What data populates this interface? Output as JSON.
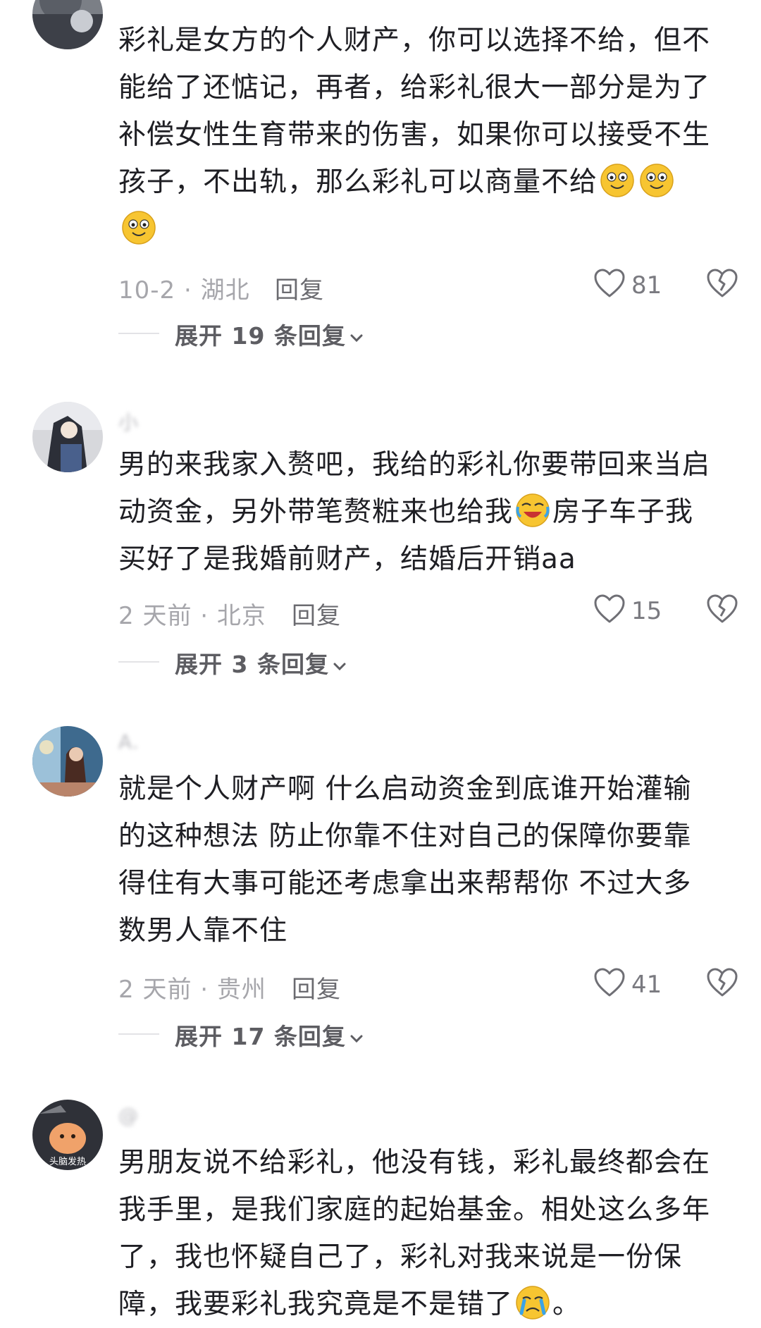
{
  "comments": [
    {
      "content_lines": [
        "彩礼是女方的个人财产，你可以选择不给，但不",
        "能给了还惦记，再者，给彩礼很大一部分是为了",
        "补偿女性生育带来的伤害，如果你可以接受不生",
        "孩子，不出轨，那么彩礼可以商量不给"
      ],
      "emojis": [
        "smile-emoji",
        "smile-emoji",
        "smile-emoji"
      ],
      "date_location": "10-2 · 湖北",
      "reply_label": "回复",
      "likes": "81",
      "expand_label": "展开 19 条回复"
    },
    {
      "username": "小",
      "content_lines": [
        "男的来我家入赘吧，我给的彩礼你要带回来当启",
        "动资金，另外带笔赘粧来也给我",
        "买好了是我婚前财产，结婚后开销aa"
      ],
      "inline_after_emoji": "房子车子我",
      "emojis": [
        "laugh-cry-emoji"
      ],
      "date_location": "2 天前 · 北京",
      "reply_label": "回复",
      "likes": "15",
      "expand_label": "展开 3 条回复"
    },
    {
      "username": "A.",
      "content_lines": [
        "就是个人财产啊   什么启动资金到底谁开始灌输",
        "的这种想法   防止你靠不住对自己的保障你要靠",
        "得住有大事可能还考虑拿出来帮帮你   不过大多",
        "数男人靠不住"
      ],
      "date_location": "2 天前 · 贵州",
      "reply_label": "回复",
      "likes": "41",
      "expand_label": "展开 17 条回复"
    },
    {
      "username": "@",
      "avatar_caption": "头脑发热",
      "content_lines": [
        "男朋友说不给彩礼，他没有钱，彩礼最终都会在",
        "我手里，是我们家庭的起始基金。相处这么多年",
        "了，我也怀疑自己了，彩礼对我来说是一份保",
        "障，我要彩礼我究竟是不是错了"
      ],
      "trailing_punct": "。",
      "emojis": [
        "crying-emoji"
      ]
    }
  ],
  "icons": {
    "like": "heart-outline-icon",
    "dislike": "broken-heart-icon",
    "expand": "chevron-down-icon"
  },
  "colors": {
    "text": "#1f1f24",
    "meta": "#a6a6ab",
    "reply": "#6b6b70",
    "expand": "#5d5d62",
    "emoji_yellow": "#f7c531"
  }
}
